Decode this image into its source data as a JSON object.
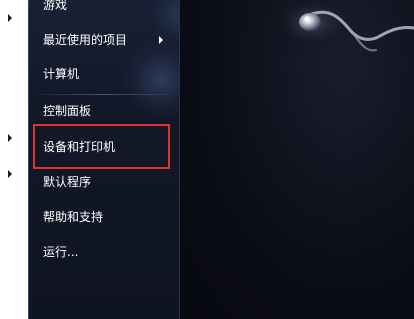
{
  "start_menu": {
    "items": [
      {
        "label": "游戏"
      },
      {
        "label": "最近使用的项目"
      },
      {
        "label": "计算机"
      },
      {
        "label": "控制面板"
      },
      {
        "label": "设备和打印机"
      },
      {
        "label": "默认程序"
      },
      {
        "label": "帮助和支持"
      },
      {
        "label": "运行..."
      }
    ]
  },
  "colors": {
    "highlight_border": "#e0332c",
    "menu_text": "#ffffff",
    "desktop_bg": "#0b0d18"
  }
}
